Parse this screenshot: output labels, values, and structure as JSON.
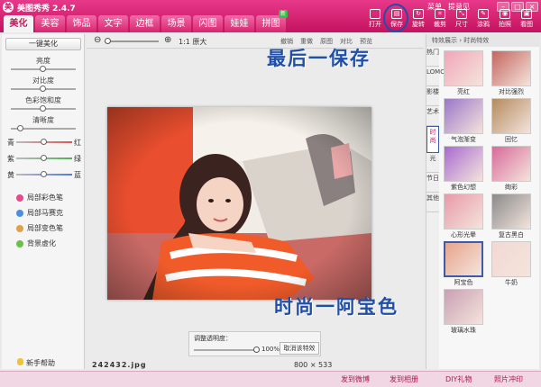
{
  "app": {
    "title": "美图秀秀 2.4.7",
    "logo": "美"
  },
  "window": {
    "links": [
      "菜单",
      "提意见"
    ],
    "buttons": [
      "–",
      "□",
      "×"
    ]
  },
  "tabs": [
    {
      "label": "美化",
      "active": true
    },
    {
      "label": "美容"
    },
    {
      "label": "饰品"
    },
    {
      "label": "文字"
    },
    {
      "label": "边框"
    },
    {
      "label": "场景"
    },
    {
      "label": "闪图"
    },
    {
      "label": "娃娃"
    },
    {
      "label": "拼图",
      "badge": "新"
    }
  ],
  "tools": [
    {
      "label": "打开",
      "icon": "folder-icon"
    },
    {
      "label": "保存",
      "icon": "save-icon"
    },
    {
      "label": "旋转",
      "icon": "rotate-icon"
    },
    {
      "label": "裁剪",
      "icon": "crop-icon"
    },
    {
      "label": "尺寸",
      "icon": "resize-icon"
    },
    {
      "label": "涂鸦",
      "icon": "brush-icon"
    },
    {
      "label": "拍照",
      "icon": "camera-icon"
    },
    {
      "label": "看图",
      "icon": "view-icon"
    }
  ],
  "left_panel": {
    "one_key": "一键美化",
    "sliders": [
      {
        "label": "亮度",
        "value": 0.5
      },
      {
        "label": "对比度",
        "value": 0.5
      },
      {
        "label": "色彩饱和度",
        "value": 0.5
      },
      {
        "label": "清晰度",
        "value": 0.15
      }
    ],
    "color_sliders": [
      {
        "left": "青",
        "right": "红",
        "value": 0.5,
        "color": "#e05656"
      },
      {
        "left": "紫",
        "right": "绿",
        "value": 0.5,
        "color": "#55b05a"
      },
      {
        "left": "黄",
        "right": "蓝",
        "value": 0.5,
        "color": "#4f7fd8"
      }
    ],
    "brushes": [
      {
        "label": "局部彩色笔",
        "color": "#e34b8a"
      },
      {
        "label": "局部马赛克",
        "color": "#4b8fe3"
      },
      {
        "label": "局部变色笔",
        "color": "#e3a04b"
      },
      {
        "label": "背景虚化",
        "color": "#6bc04b"
      }
    ],
    "help": "新手帮助"
  },
  "topbar": {
    "zoom_minus": "⊖",
    "zoom_plus": "⊕",
    "orig": "1:1 原大",
    "edit": [
      "撤销",
      "重做",
      "原图",
      "对比",
      "预览"
    ]
  },
  "canvas": {
    "opacity_label": "调整透明度：",
    "opacity_value": "100%",
    "opacity_level": 1,
    "cancel": "取消该特效",
    "filename": "242432.jpg",
    "dims": "800 × 533"
  },
  "right_panel": {
    "header": "特效展示 › 时尚特效",
    "vtabs": [
      "热门",
      "LOMO",
      "影楼",
      "时尚",
      "艺术",
      "光",
      "节日",
      "其他"
    ],
    "effects": [
      {
        "label": "亮红",
        "color": "#f2a6b8"
      },
      {
        "label": "对比强烈",
        "color": "#c4655e"
      },
      {
        "label": "气泡渐变",
        "color": "#9a76c9"
      },
      {
        "label": "回忆",
        "color": "#b48a5e"
      },
      {
        "label": "紫色幻想",
        "color": "#a86ad0"
      },
      {
        "label": "绚彩",
        "color": "#d86a9a"
      },
      {
        "label": "心形光晕",
        "color": "#e79aa8"
      },
      {
        "label": "复古黑白",
        "color": "#8a8a8a"
      },
      {
        "label": "阿宝色",
        "color": "#e8a48c"
      },
      {
        "label": "牛奶",
        "color": "#f1d9d2"
      },
      {
        "label": "玻璃水珠",
        "color": "#c99fb4"
      }
    ]
  },
  "statusbar": [
    "发到微博",
    "发到相册",
    "DIY礼物",
    "照片冲印"
  ],
  "annotations": {
    "save": "最后一保存",
    "effect": "时尚一阿宝色"
  }
}
